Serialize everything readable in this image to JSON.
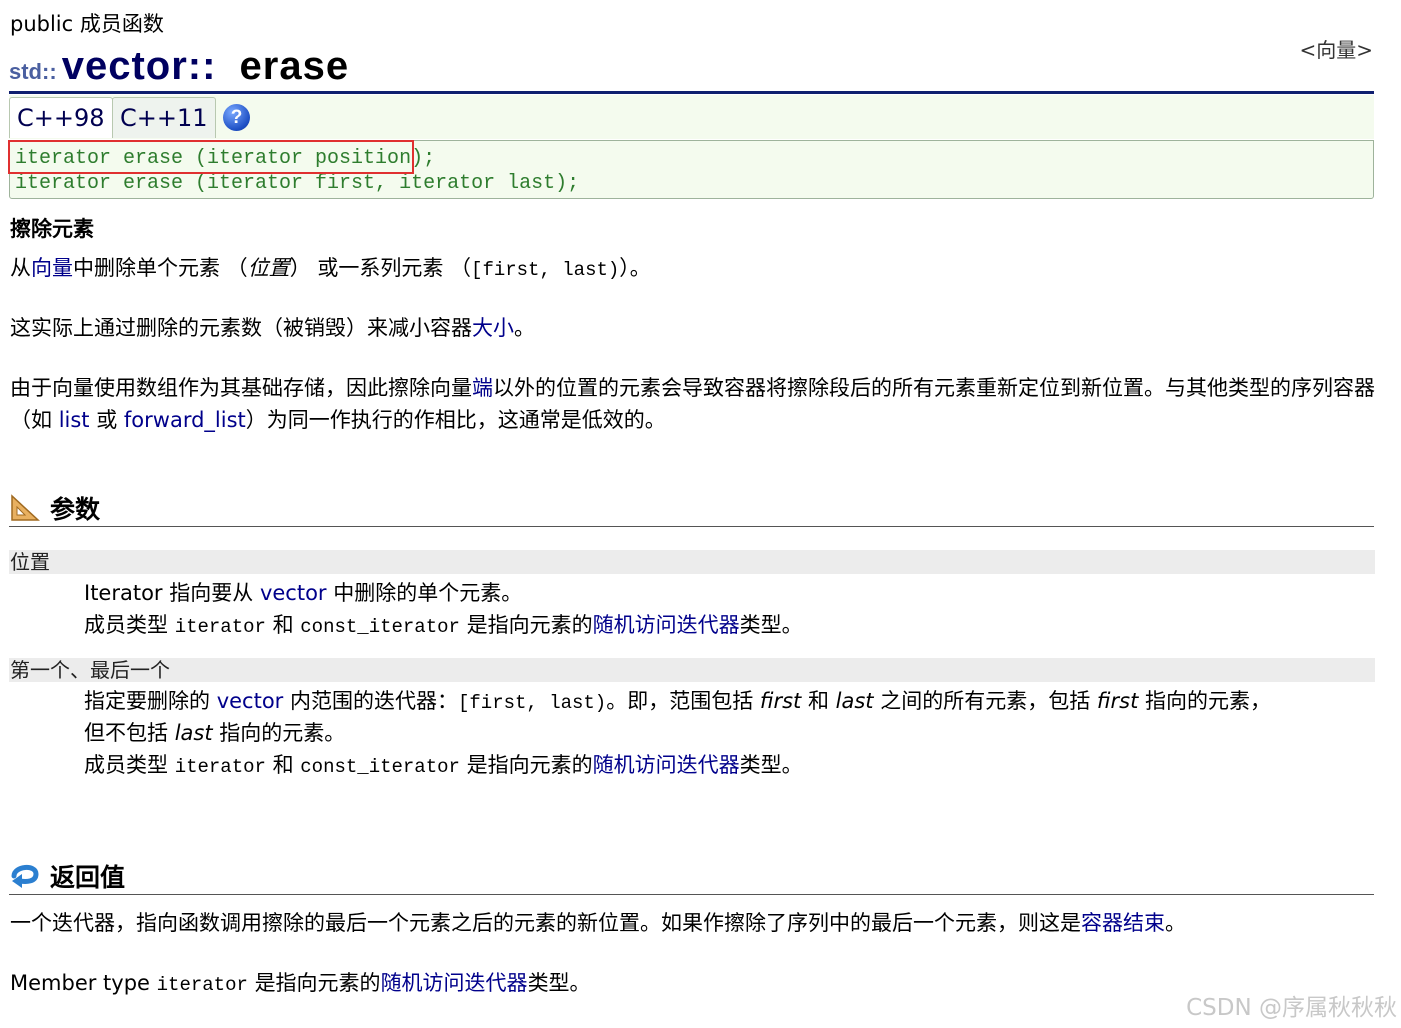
{
  "header": {
    "access": "public 成员函数",
    "parent_link": "<向量>",
    "title_ns": "std::",
    "title_class": "vector::",
    "title_fn": "erase"
  },
  "tabs": [
    "C++98",
    "C++11"
  ],
  "help_label": "?",
  "declarations": [
    "iterator erase (iterator position);",
    "iterator erase (iterator first, iterator last);"
  ],
  "summary_title": "擦除元素",
  "para1": {
    "t1": "从",
    "link_vector": "向量",
    "t2": "中删除单个元素 （",
    "position": "位置",
    "t3": "） 或一系列元素 （",
    "range": "[first, last)",
    "t4": "）。"
  },
  "para2": {
    "t1": "这实际上通过删除的元素数（被销毁）来减小容器",
    "link_size": "大小",
    "t2": "。"
  },
  "para3": {
    "t1": "由于向量使用数组作为其基础存储，因此擦除向量",
    "link_end": "端",
    "t2": "以外的位置的元素会导致容器将擦除段后的所有元素重新定位到新位置。与其他类型的序列容器（如",
    "link_list": "list",
    "t3": "或",
    "link_flist": "forward_list",
    "t4": "）为同一作执行的作相比，这通常是低效的。"
  },
  "params_section": {
    "title": "参数",
    "items": [
      {
        "name": "位置",
        "line1": {
          "t1": "Iterator 指向要从",
          "link": "vector",
          "t2": "中删除的单个元素。"
        },
        "line2": {
          "t1": "成员类型",
          "c1": "iterator",
          "t2": "和",
          "c2": "const_iterator",
          "t3": "是指向元素的",
          "link": "随机访问迭代器",
          "t4": "类型。"
        }
      },
      {
        "name": "第一个、最后一个",
        "line1": {
          "t1": "指定要删除的",
          "link": "vector",
          "t2": "内范围的迭代器：",
          "range": "[first, last)",
          "t3": "。即，范围包括",
          "first": "first",
          "t4": "和",
          "last": "last",
          "t5": "之间的所有元素，包括",
          "first2": "first",
          "t6": "指向的元素，"
        },
        "line1b": {
          "t1": "但不包括",
          "last": "last",
          "t2": "指向的元素。"
        },
        "line2": {
          "t1": "成员类型",
          "c1": "iterator",
          "t2": "和",
          "c2": "const_iterator",
          "t3": "是指向元素的",
          "link": "随机访问迭代器",
          "t4": "类型。"
        }
      }
    ]
  },
  "return_section": {
    "title": "返回值",
    "p1": {
      "t1": "一个迭代器，指向函数调用擦除的最后一个元素之后的元素的新位置。如果作擦除了序列中的最后一个元素，则这是",
      "link": "容器结束",
      "t2": "。"
    },
    "p2": {
      "t1": "Member type",
      "code": "iterator",
      "t2": "是指向元素的",
      "link": "随机访问迭代器",
      "t3": "类型。"
    }
  },
  "watermark": "CSDN @序属秋秋秋"
}
